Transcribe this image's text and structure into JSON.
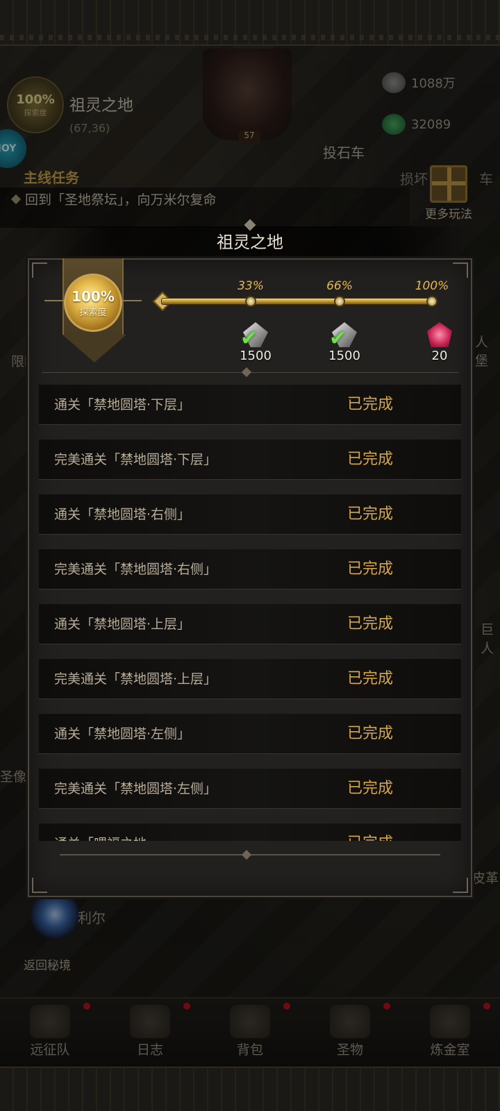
{
  "background": {
    "location": {
      "percent": "100%",
      "percent_label": "探索度",
      "name": "祖灵之地",
      "coords": "(67,36)"
    },
    "boss_level": "57",
    "resources": [
      {
        "icon": "silver-ore-icon",
        "value": "1088万"
      },
      {
        "icon": "green-gem-icon",
        "value": "32089"
      }
    ],
    "catapult_label": "投石车",
    "damaged_label": "损坏",
    "damaged_label_2": "车",
    "quest": {
      "title": "主线任务",
      "text": "回到「圣地祭坛」，向万米尔复命"
    },
    "joy_icon_text": "JOY",
    "more_play_label": "更多玩法",
    "side_labels": {
      "limit": "限时",
      "giant_fort": "人堡",
      "giant": "巨人",
      "statue": "圣像",
      "leather": "皮革"
    },
    "portal_label": "返回秘境",
    "npc_name": "利尔"
  },
  "bottom_nav": [
    {
      "label": "远征队",
      "icon": "helmet-icon"
    },
    {
      "label": "日志",
      "icon": "scroll-icon"
    },
    {
      "label": "背包",
      "icon": "backpack-icon"
    },
    {
      "label": "圣物",
      "icon": "chalice-icon"
    },
    {
      "label": "炼金室",
      "icon": "alchemy-icon"
    }
  ],
  "modal": {
    "title": "祖灵之地",
    "exploration": {
      "percent": "100%",
      "label": "探索度"
    },
    "progress": 1.0,
    "milestones": [
      {
        "label": "33%",
        "reward_icon": "silver-ore-icon",
        "qty": "1500",
        "claimed": true
      },
      {
        "label": "66%",
        "reward_icon": "silver-ore-icon",
        "qty": "1500",
        "claimed": true
      },
      {
        "label": "100%",
        "reward_icon": "ruby-crystal-icon",
        "qty": "20",
        "claimed": false
      }
    ],
    "tasks": [
      {
        "text": "通关「禁地圆塔·下层」",
        "status": "已完成"
      },
      {
        "text": "完美通关「禁地圆塔·下层」",
        "status": "已完成"
      },
      {
        "text": "通关「禁地圆塔·右侧」",
        "status": "已完成"
      },
      {
        "text": "完美通关「禁地圆塔·右侧」",
        "status": "已完成"
      },
      {
        "text": "通关「禁地圆塔·上层」",
        "status": "已完成"
      },
      {
        "text": "完美通关「禁地圆塔·上层」",
        "status": "已完成"
      },
      {
        "text": "通关「禁地圆塔·左侧」",
        "status": "已完成"
      },
      {
        "text": "完美通关「禁地圆塔·左侧」",
        "status": "已完成"
      },
      {
        "text": "通关「喂福之地",
        "status": "已完成"
      }
    ]
  },
  "colors": {
    "accent_gold": "#d6a84c",
    "check_green": "#6fe04a",
    "panel": "#232120",
    "notify_red": "#c0141c"
  }
}
